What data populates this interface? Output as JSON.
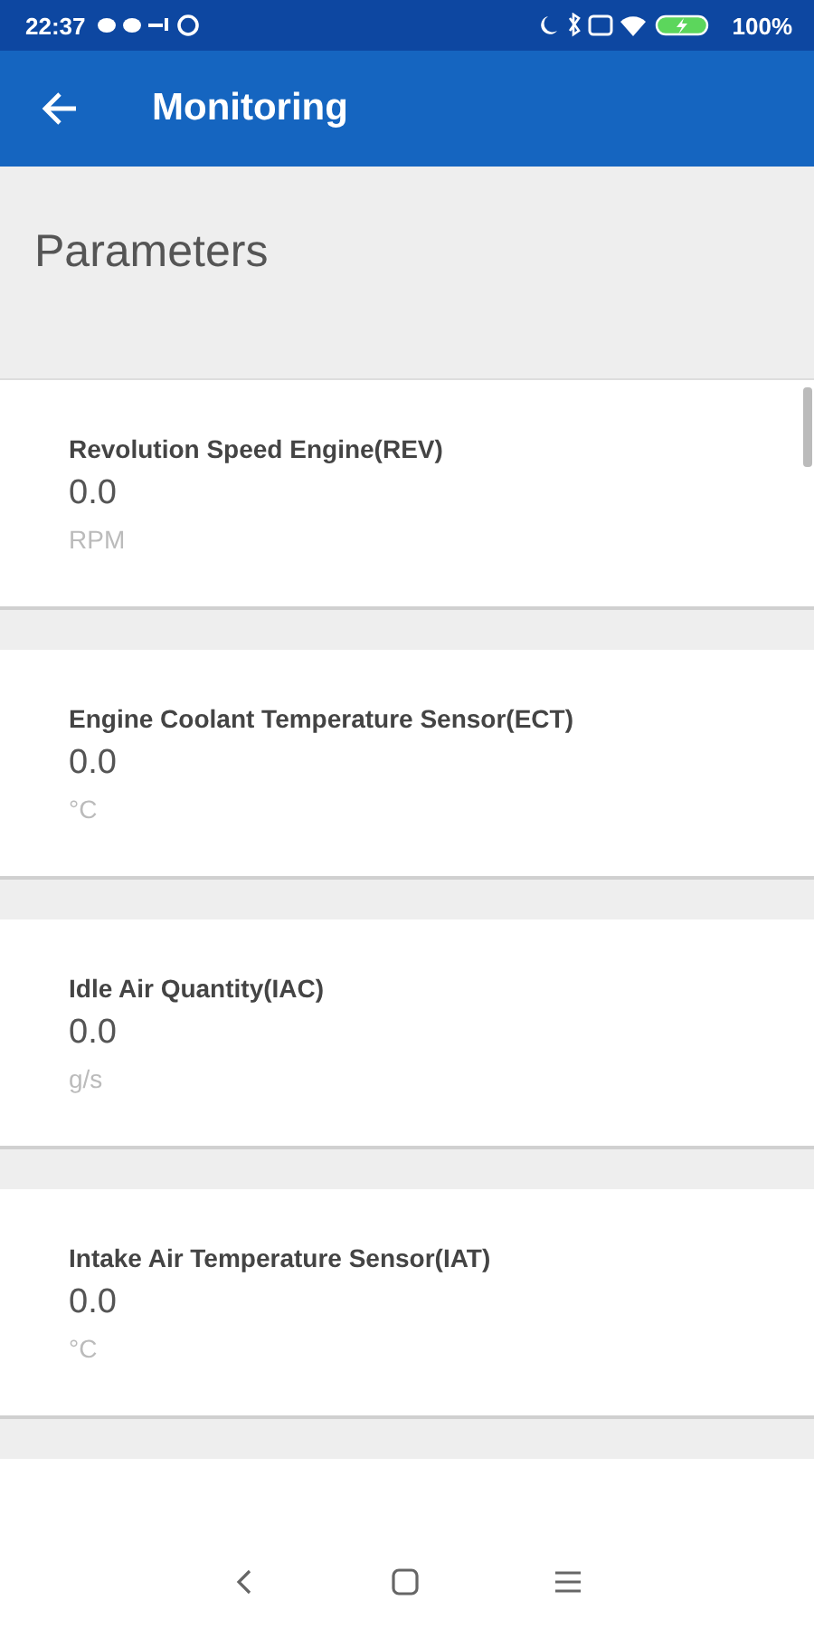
{
  "status_bar": {
    "time": "22:37",
    "battery": "100%"
  },
  "app_bar": {
    "title": "Monitoring"
  },
  "section": {
    "title": "Parameters"
  },
  "parameters": [
    {
      "name": "Revolution Speed Engine(REV)",
      "value": "0.0",
      "unit": "RPM"
    },
    {
      "name": "Engine Coolant Temperature Sensor(ECT)",
      "value": "0.0",
      "unit": "°C"
    },
    {
      "name": "Idle Air Quantity(IAC)",
      "value": "0.0",
      "unit": "g/s"
    },
    {
      "name": "Intake Air Temperature Sensor(IAT)",
      "value": "0.0",
      "unit": "°C"
    }
  ]
}
